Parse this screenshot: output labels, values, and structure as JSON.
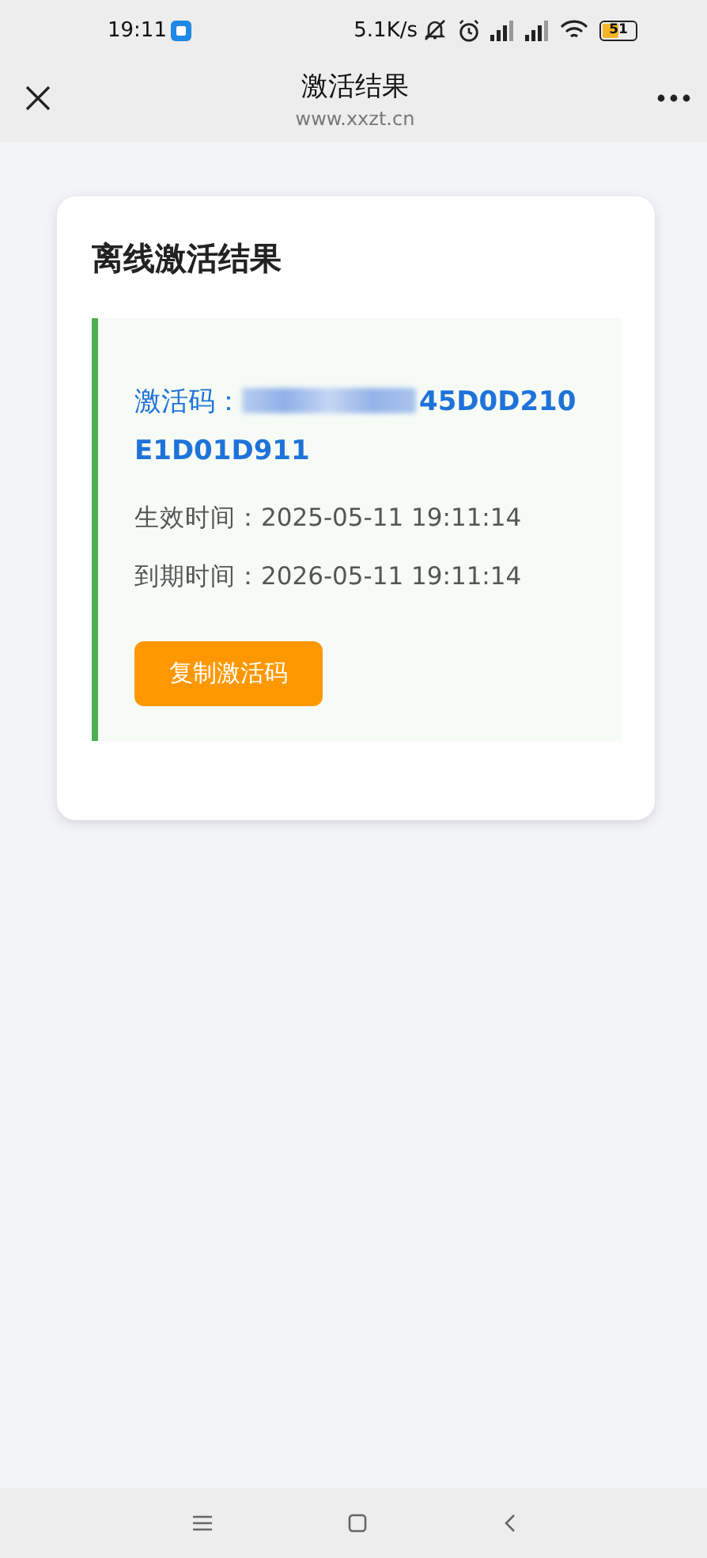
{
  "status_bar": {
    "time": "19:11",
    "net_speed": "5.1K/s",
    "battery": "51"
  },
  "nav": {
    "title": "激活结果",
    "url": "www.xxzt.cn"
  },
  "card": {
    "title": "离线激活结果",
    "code_label": "激活码：",
    "code_lines": [
      "45D0D210",
      "E1D01D911"
    ],
    "lines": [
      {
        "label": "生效时间：",
        "value": "2025-05-11 19:11:14"
      },
      {
        "label": "到期时间：",
        "value": "2026-05-11 19:11:14"
      }
    ],
    "button": "复制激活码"
  }
}
